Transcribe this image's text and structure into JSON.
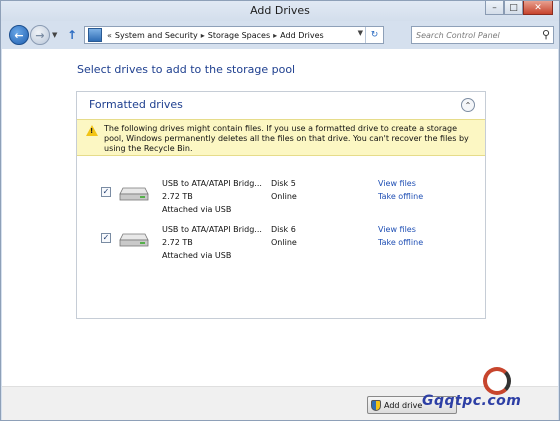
{
  "window": {
    "title": "Add Drives"
  },
  "navigation": {
    "breadcrumbs": [
      "System and Security",
      "Storage Spaces",
      "Add Drives"
    ],
    "search_placeholder": "Search Control Panel"
  },
  "page": {
    "title": "Select drives to add to the storage pool",
    "group_title": "Formatted drives",
    "warning": "The following drives might contain files. If you use a formatted drive to create a storage pool, Windows permanently deletes all the files on that drive. You can't recover the files by using the Recycle Bin."
  },
  "drives": [
    {
      "name": "USB to ATA/ATAPI Bridg...",
      "size": "2.72 TB",
      "connection": "Attached via USB",
      "disk": "Disk 5",
      "status": "Online",
      "view_label": "View files",
      "offline_label": "Take offline",
      "checked": true
    },
    {
      "name": "USB to ATA/ATAPI Bridg...",
      "size": "2.72 TB",
      "connection": "Attached via USB",
      "disk": "Disk 6",
      "status": "Online",
      "view_label": "View files",
      "offline_label": "Take offline",
      "checked": true
    }
  ],
  "footer": {
    "add_button": "Add drive",
    "watermark": "Gqqtpc.com"
  },
  "colors": {
    "heading": "#1e3f8f",
    "link": "#1f4fb4",
    "warning_bg": "#fcf7c3",
    "chrome": "#d5e0ee"
  },
  "icons": [
    "back-icon",
    "forward-icon",
    "up-icon",
    "refresh-icon",
    "search-icon",
    "collapse-icon",
    "warning-icon",
    "drive-icon",
    "shield-icon"
  ]
}
